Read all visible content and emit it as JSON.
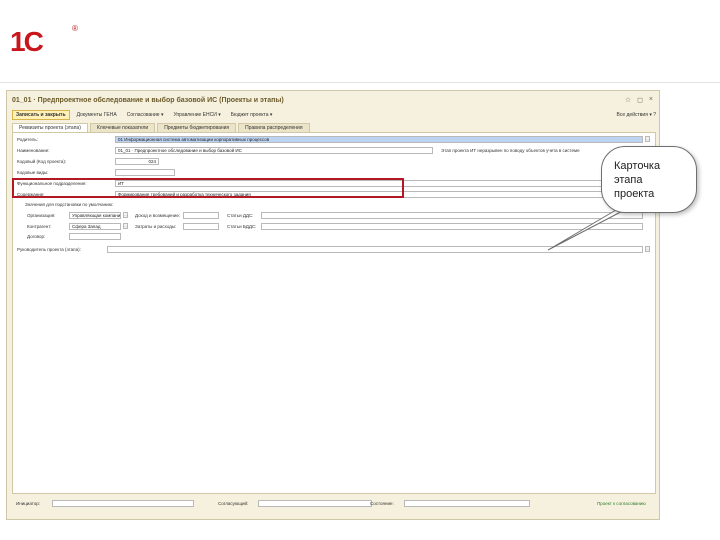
{
  "logo": {
    "mark": "1C",
    "reg": "®"
  },
  "window": {
    "title": "01_01 · Предпроектное обследование и выбор базовой ИС (Проекты и этапы)",
    "controls": [
      "☆",
      "◻",
      "×"
    ]
  },
  "toolbar": {
    "primary": "Записать и закрыть",
    "buttons": [
      "Документы ГЕНА",
      "Согласование ▾",
      "Управление ЕНСИ ▾",
      "Бюджет проекта ▾"
    ],
    "right": "Все действия ▾ ?"
  },
  "tabs": [
    "Реквизиты проекта (этапа)",
    "Ключевые показатели",
    "Предметы бюджетирования",
    "Правила распределения"
  ],
  "form": {
    "parent_label": "Родитель:",
    "parent_value": "01 Информационная система автоматизации корпоративных процессов",
    "name_label": "Наименование:",
    "name_value": "01_01 · Предпроектное обследование и выбор базовой ИС",
    "code_label": "Кодовый (Код проекта):",
    "code_value": "024",
    "kind_label": "Кодовые виды:",
    "check_label": "Этап проекта ИТ неразрывен по поводу объектов учета в системе",
    "func_label": "Функциональное подразделение:",
    "func_value": "ИТ",
    "content_label": "Содержание:",
    "content_value": "Формирование требований и разработка технического задания",
    "group_title": "Значения для подстановки по умолчанию:",
    "org_label": "Организация:",
    "org_value": "Управляющая компания",
    "counter_label": "Контрагент:",
    "counter_value": "Сфера Запад",
    "contract_label": "Договор:",
    "income_label": "Доход и возмещение:",
    "expense_label": "Затраты и расходы:",
    "dds_label": "Статьи ДДС:",
    "bdds_label": "Статьи БДДС:",
    "resp_label": "Руководитель проекта (этапа):"
  },
  "bottom": {
    "initiator_label": "Инициатор:",
    "approver_label": "Согласующий:",
    "status_label": "Состояние:",
    "status_value": "",
    "approve_label": "Проект к согласованию"
  },
  "callout": {
    "lines": [
      "Карточка",
      "этапа",
      "проекта"
    ]
  },
  "colors": {
    "brand_red": "#c8161d",
    "highlight_red": "#b11a23",
    "window_bg": "#f6f1de"
  }
}
